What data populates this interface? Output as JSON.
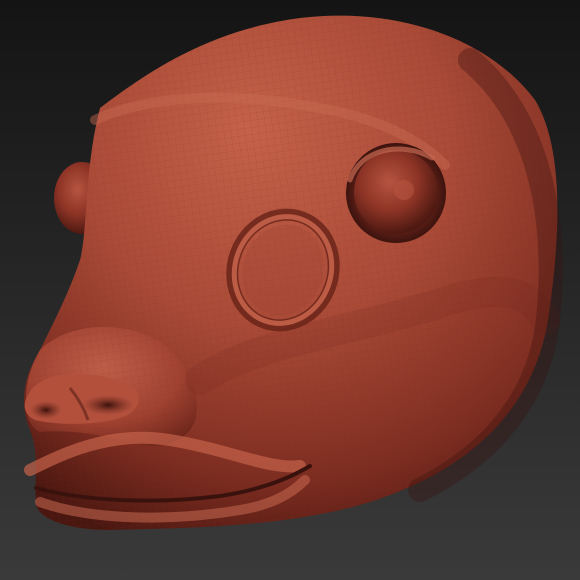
{
  "scene": {
    "subject": "sculpted-head-model",
    "colors": {
      "background_top": "#141414",
      "background_bottom": "#3a3a3a",
      "clay_highlight": "#c4624a",
      "clay_mid": "#a24332",
      "clay_shadow": "#5a1e16",
      "clay_deep": "#3a120d",
      "wire": "#7a2c20"
    }
  }
}
